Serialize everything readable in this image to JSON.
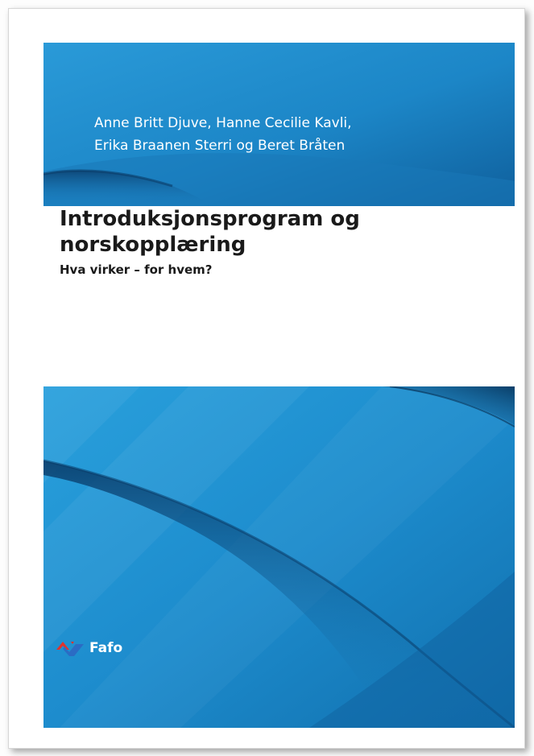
{
  "cover": {
    "authors": [
      "Anne Britt Djuve, Hanne Cecilie Kavli,",
      "Erika Braanen Sterri og Beret Bråten"
    ],
    "title_lines": [
      "Introduksjonsprogram og",
      "norskopplæring"
    ],
    "subtitle": "Hva virker – for hvem?",
    "publisher": "Fafo"
  },
  "colors": {
    "panel_blue": "#1f8fd0",
    "panel_dark_blue": "#0c5a94",
    "logo_red": "#e2322b",
    "logo_blue": "#2b6cc4"
  }
}
